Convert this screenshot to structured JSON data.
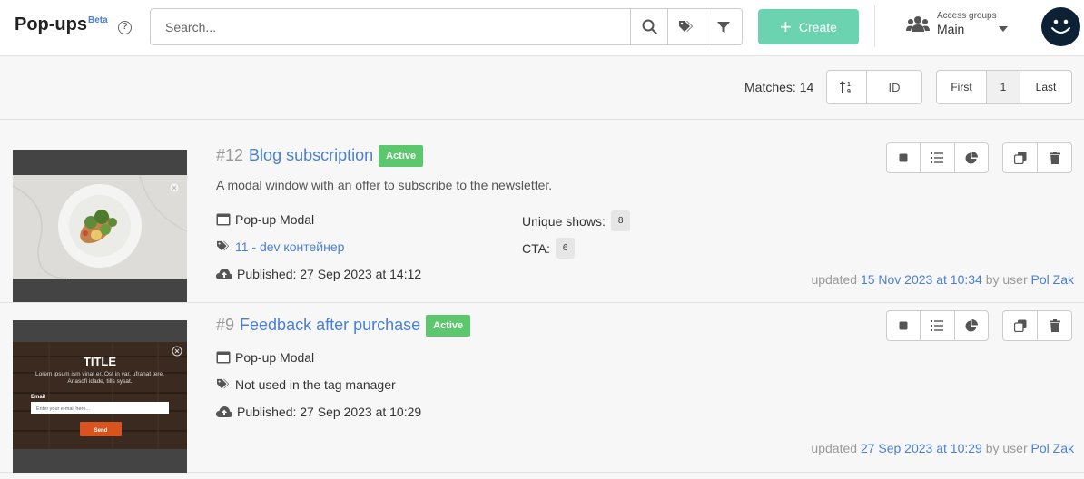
{
  "header": {
    "title": "Pop-ups",
    "beta": "Beta",
    "help": "?",
    "search_placeholder": "Search...",
    "create_label": "Create",
    "access_label": "Access groups",
    "access_value": "Main"
  },
  "toolbar": {
    "matches": "Matches: 14",
    "sort_field": "ID",
    "page_first": "First",
    "page_current": "1",
    "page_last": "Last"
  },
  "items": [
    {
      "number": "#12",
      "name": "Blog subscription",
      "status": "Active",
      "description": "A modal window with an offer to subscribe to the newsletter.",
      "type": "Pop-up Modal",
      "tag": "11 - dev контейнер",
      "published": "Published: 27 Sep 2023 at 14:12",
      "unique_shows_label": "Unique shows:",
      "unique_shows": "8",
      "cta_label": "CTA:",
      "cta": "6",
      "updated_prefix": "updated",
      "updated_date": "15 Nov 2023 at 10:34",
      "updated_by": "by user",
      "updated_user": "Pol Zak"
    },
    {
      "number": "#9",
      "name": "Feedback after purchase",
      "status": "Active",
      "type": "Pop-up Modal",
      "tag": "Not used in the tag manager",
      "published": "Published: 27 Sep 2023 at 10:29",
      "updated_prefix": "updated",
      "updated_date": "27 Sep 2023 at 10:29",
      "updated_by": "by user",
      "updated_user": "Pol Zak",
      "preview": {
        "title": "TITLE",
        "text": "Lorem ipsum ism vinat er. Ost in var, ufranat tere. Anasofi idade, tills sysat.",
        "email_label": "Email",
        "email_placeholder": "Enter your e-mail here...",
        "send": "Send"
      }
    }
  ],
  "colors": {
    "accent": "#4a7fd6",
    "create": "#6cd3b0",
    "active": "#5cc76c"
  }
}
